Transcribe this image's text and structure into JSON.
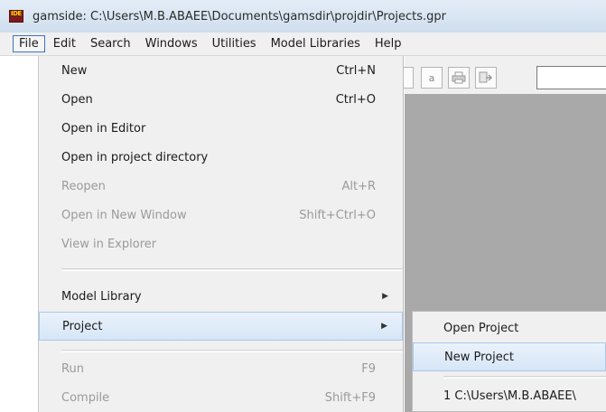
{
  "window": {
    "title": "gamside: C:\\Users\\M.B.ABAEE\\Documents\\gamsdir\\projdir\\Projects.gpr",
    "icon": "gamside-app-icon",
    "icon_text": "IDE"
  },
  "menubar": {
    "items": [
      "File",
      "Edit",
      "Search",
      "Windows",
      "Utilities",
      "Model Libraries",
      "Help"
    ]
  },
  "toolbar": {
    "font_button_label": "a"
  },
  "file_menu": {
    "items": [
      {
        "label": "New",
        "shortcut": "Ctrl+N",
        "enabled": true
      },
      {
        "label": "Open",
        "shortcut": "Ctrl+O",
        "enabled": true
      },
      {
        "label": "Open in Editor",
        "shortcut": "",
        "enabled": true
      },
      {
        "label": "Open in project directory",
        "shortcut": "",
        "enabled": true
      },
      {
        "label": "Reopen",
        "shortcut": "Alt+R",
        "enabled": false
      },
      {
        "label": "Open in New Window",
        "shortcut": "Shift+Ctrl+O",
        "enabled": false
      },
      {
        "label": "View in Explorer",
        "shortcut": "",
        "enabled": false
      },
      {
        "label": "Model Library",
        "shortcut": "",
        "enabled": true,
        "submenu": true
      },
      {
        "label": "Project",
        "shortcut": "",
        "enabled": true,
        "submenu": true,
        "highlighted": true
      },
      {
        "label": "Run",
        "shortcut": "F9",
        "enabled": false
      },
      {
        "label": "Compile",
        "shortcut": "Shift+F9",
        "enabled": false
      }
    ]
  },
  "project_submenu": {
    "items": [
      {
        "label": "Open Project"
      },
      {
        "label": "New Project",
        "highlighted": true
      },
      {
        "label": "1 C:\\Users\\M.B.ABAEE\\"
      }
    ]
  },
  "colors": {
    "highlight": "#d6e6f7",
    "workspace": "#a9a9a9",
    "menu_bg": "#f0f0f0",
    "disabled_text": "#9a9a9a"
  }
}
